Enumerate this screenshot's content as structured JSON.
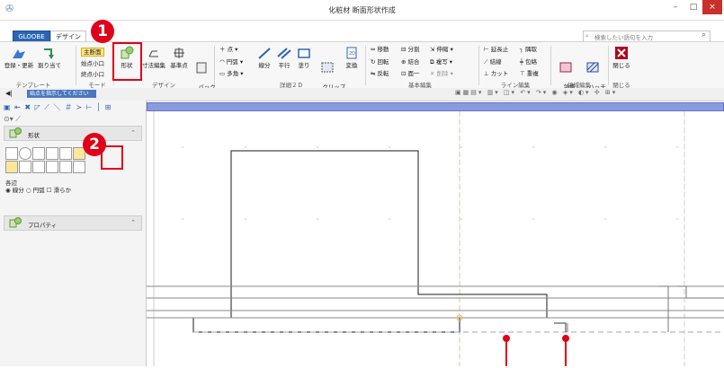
{
  "window": {
    "title": "化粧材 断面形状作成",
    "min": "–",
    "max": "□",
    "close": "×"
  },
  "tabs": [
    {
      "label": "GLOOBE"
    },
    {
      "label": "デザイン"
    },
    {
      "label": ""
    }
  ],
  "search": {
    "placeholder": "検索したい語句を入力"
  },
  "ribbon": {
    "template": {
      "btn1": "登録・更新",
      "btn2": "割り当て",
      "group": "テンプレート"
    },
    "mode": {
      "main": "主断面",
      "start": "始点小口",
      "end": "終点小口",
      "group": "モード"
    },
    "design": {
      "shape": "形状",
      "dim": "寸法編集",
      "base": "基準点",
      "back": "バック\n表示",
      "group": "デザイン"
    },
    "detail2d": {
      "point": "点",
      "arc": "円弧",
      "poly": "多角",
      "line": "線分",
      "parallel": "平行",
      "fill": "塗り",
      "clip": "クリップ\n領域",
      "convert": "変換",
      "group": "詳細２Ｄ"
    },
    "basic": {
      "move": "移動",
      "rotate": "回転",
      "mirror": "反転",
      "split": "分割",
      "join": "結合",
      "unify": "面一",
      "stretch": "伸縮",
      "copy": "複写",
      "delete": "削除",
      "group": "基本編集"
    },
    "line": {
      "extend": "延長止",
      "chamfer": "隅取",
      "connect": "結線",
      "wrap": "包絡",
      "cut": "カット",
      "overlap": "重複",
      "group": "ライン編集"
    },
    "region": {
      "region": "領域\n編集",
      "hatch": "ハッチ\n編集",
      "group": "領域編集"
    },
    "close": {
      "label": "閉じる",
      "group": "閉じる"
    }
  },
  "toolbar": {
    "prompt": "始点を指示してください"
  },
  "panels": {
    "shape": "形状",
    "property": "プロパティ"
  },
  "shape_options": {
    "label": "各辺",
    "opt1": "線分",
    "opt2": "円弧",
    "opt3": "滑らか"
  },
  "callouts": {
    "c1": "1",
    "c2": "2"
  },
  "colors": {
    "accent": "#e10019",
    "tab": "#2a66b4",
    "bar": "#8a9cdf"
  }
}
